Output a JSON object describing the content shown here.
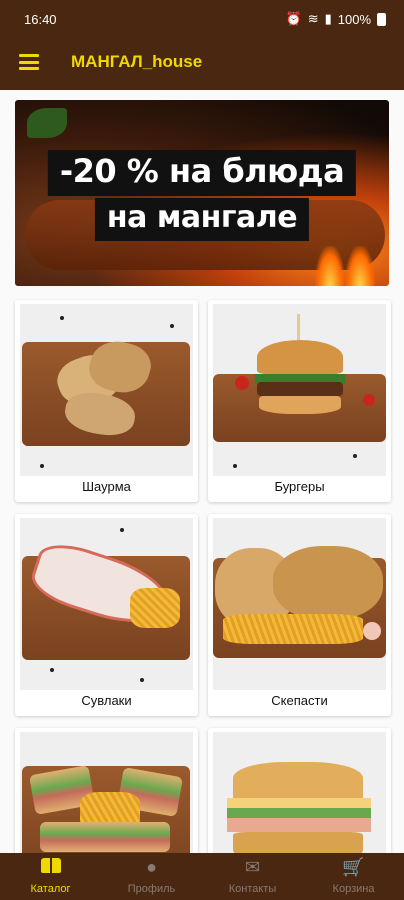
{
  "status_bar": {
    "time": "16:40",
    "battery": "100%",
    "icons": [
      "alarm-icon",
      "wifi-icon",
      "signal-icon",
      "signal-icon",
      "battery-icon"
    ]
  },
  "app_bar": {
    "title": "МАНГАЛ_house",
    "menu_icon": "hamburger-menu-icon"
  },
  "banner": {
    "line1": "-20 % на блюда",
    "line2": "на мангале"
  },
  "categories": [
    {
      "label": "Шаурма"
    },
    {
      "label": "Бургеры"
    },
    {
      "label": "Сувлаки"
    },
    {
      "label": "Скепасти"
    },
    {
      "label": ""
    },
    {
      "label": ""
    }
  ],
  "bottom_nav": [
    {
      "label": "Каталог",
      "icon": "book-icon",
      "active": true
    },
    {
      "label": "Профиль",
      "icon": "person-icon",
      "active": false
    },
    {
      "label": "Контакты",
      "icon": "mail-icon",
      "active": false
    },
    {
      "label": "Корзина",
      "icon": "cart-icon",
      "active": false
    }
  ],
  "colors": {
    "primary": "#4a2711",
    "accent": "#f0d900",
    "inactive": "#8a7a70"
  }
}
